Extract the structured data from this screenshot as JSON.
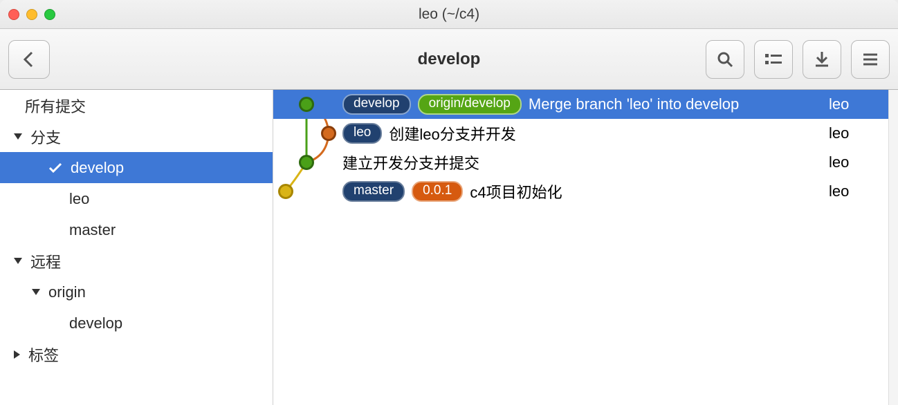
{
  "window": {
    "title": "leo (~/c4)"
  },
  "toolbar": {
    "branch_title": "develop"
  },
  "sidebar": {
    "all_commits": "所有提交",
    "branches_label": "分支",
    "branches": [
      {
        "name": "develop",
        "selected": true,
        "checked": true
      },
      {
        "name": "leo"
      },
      {
        "name": "master"
      }
    ],
    "remotes_label": "远程",
    "remote_name": "origin",
    "remote_branches": [
      {
        "name": "develop"
      }
    ],
    "tags_label": "标签"
  },
  "commits": [
    {
      "refs": [
        {
          "label": "develop",
          "style": "blue"
        },
        {
          "label": "origin/develop",
          "style": "green"
        }
      ],
      "message": "Merge branch 'leo' into develop",
      "author": "leo",
      "selected": true,
      "node": {
        "x": 48,
        "color_fill": "#4aa018",
        "color_border": "#2e6a0f"
      }
    },
    {
      "refs": [
        {
          "label": "leo",
          "style": "blue-dark"
        }
      ],
      "message": "创建leo分支并开发",
      "author": "leo",
      "node": {
        "x": 80,
        "color_fill": "#d46a1e",
        "color_border": "#8a3e0a"
      }
    },
    {
      "refs": [],
      "message": "建立开发分支并提交",
      "author": "leo",
      "node": {
        "x": 48,
        "color_fill": "#4aa018",
        "color_border": "#2e6a0f"
      }
    },
    {
      "refs": [
        {
          "label": "master",
          "style": "blue-dark"
        },
        {
          "label": "0.0.1",
          "style": "orange"
        }
      ],
      "message": "c4项目初始化",
      "author": "leo",
      "node": {
        "x": 18,
        "color_fill": "#d9b417",
        "color_border": "#a88600"
      }
    }
  ]
}
